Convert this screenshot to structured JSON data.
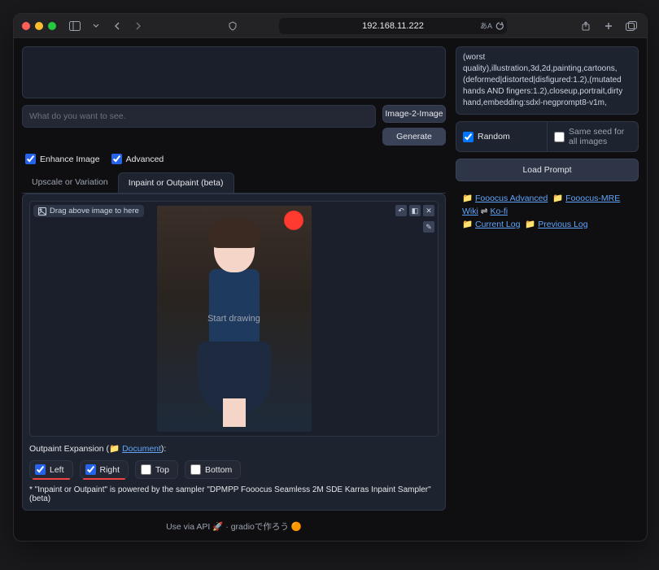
{
  "browser": {
    "url": "192.168.11.222",
    "reader_badge": "あA"
  },
  "prompt": {
    "placeholder": "What do you want to see.",
    "image2image_btn": "Image-2-Image",
    "generate_btn": "Generate"
  },
  "checks": {
    "enhance_label": "Enhance Image",
    "enhance_checked": true,
    "advanced_label": "Advanced",
    "advanced_checked": true
  },
  "tabs": {
    "upscale": "Upscale or Variation",
    "inpaint": "Inpaint or Outpaint (beta)",
    "active": "inpaint"
  },
  "canvas": {
    "drag_hint": "Drag above image to here",
    "start_drawing": "Start drawing"
  },
  "outpaint": {
    "label_prefix": "Outpaint Expansion (",
    "doc_link": "Document",
    "label_suffix": "):",
    "directions": [
      {
        "label": "Left",
        "checked": true,
        "highlight": true
      },
      {
        "label": "Right",
        "checked": true,
        "highlight": true
      },
      {
        "label": "Top",
        "checked": false,
        "highlight": false
      },
      {
        "label": "Bottom",
        "checked": false,
        "highlight": false
      }
    ],
    "note": "* \"Inpaint or Outpaint\" is powered by the sampler \"DPMPP Fooocus Seamless 2M SDE Karras Inpaint Sampler\" (beta)"
  },
  "footer": {
    "api": "Use via API",
    "sep": "·",
    "gradio": "gradioで作ろう"
  },
  "sidebar": {
    "negative_prompt": "(worst quality),illustration,3d,2d,painting,cartoons,(deformed|distorted|disfigured:1.2),(mutated hands AND fingers:1.2),closeup,portrait,dirty hand,embedding:sdxl-negprompt8-v1m,",
    "random_label": "Random",
    "random_checked": true,
    "same_seed_label": "Same seed for all images",
    "same_seed_checked": false,
    "load_prompt_btn": "Load Prompt",
    "links": {
      "advanced": "Fooocus Advanced",
      "wiki": "Fooocus-MRE Wiki",
      "sep": "⇌",
      "kofi": "Ko-fi",
      "current_log": "Current Log",
      "previous_log": "Previous Log"
    }
  }
}
